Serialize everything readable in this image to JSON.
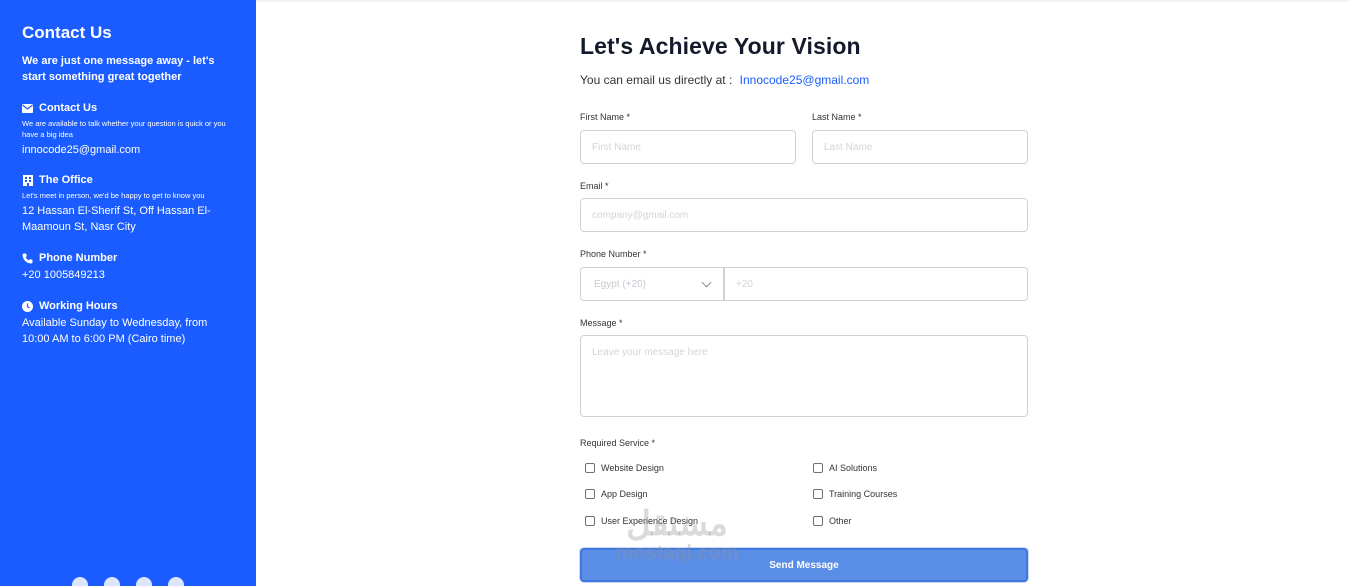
{
  "sidebar": {
    "title": "Contact Us",
    "intro": "We are just one message away - let's start something great together",
    "sections": [
      {
        "icon": "envelope-icon",
        "heading": "Contact Us",
        "small": "We are available to talk whether your question is quick or you have a big idea",
        "value": "innocode25@gmail.com"
      },
      {
        "icon": "building-icon",
        "heading": "The Office",
        "small": "Let's meet in person, we'd be happy to get to know you",
        "value": "12 Hassan El-Sherif St, Off Hassan El-Maamoun St, Nasr City"
      },
      {
        "icon": "phone-icon",
        "heading": "Phone Number",
        "small": "",
        "value": "+20 1005849213"
      },
      {
        "icon": "clock-icon",
        "heading": "Working Hours",
        "small": "",
        "value": "Available Sunday to Wednesday, from 10:00 AM to 6:00 PM (Cairo time)"
      }
    ],
    "social": [
      "facebook-icon",
      "linkedin-icon",
      "github-icon",
      "whatsapp-icon"
    ],
    "bg_color": "#1a5cff"
  },
  "form": {
    "title": "Let's Achieve Your Vision",
    "subtitle": "You can email us directly at :",
    "email_link": "Innocode25@gmail.com",
    "first_name": {
      "label": "First Name *",
      "placeholder": "First Name"
    },
    "last_name": {
      "label": "Last Name *",
      "placeholder": "Last Name"
    },
    "email": {
      "label": "Email *",
      "placeholder": "company@gmail.com"
    },
    "phone": {
      "label": "Phone Number *",
      "country": "Egypt (+20)",
      "placeholder": "+20"
    },
    "message": {
      "label": "Message *",
      "placeholder": "Leave your message here"
    },
    "services_label": "Required Service *",
    "services": [
      "Website Design",
      "AI Solutions",
      "App Design",
      "Training Courses",
      "User Experience Design",
      "Other"
    ],
    "send_label": "Send Message",
    "accent_color": "#1a5cff"
  },
  "watermark": {
    "arabic": "مستقل",
    "latin": "mostaql.com"
  }
}
